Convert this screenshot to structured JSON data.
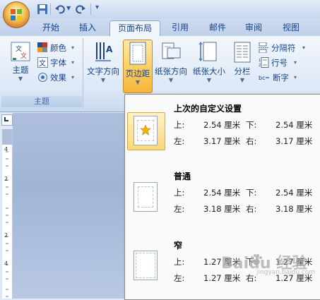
{
  "tabs": [
    "开始",
    "插入",
    "页面布局",
    "引用",
    "邮件",
    "审阅",
    "视图"
  ],
  "ribbon": {
    "theme_group": {
      "themes_label": "主题",
      "colors_label": "颜色",
      "fonts_label": "字体",
      "effects_label": "效果",
      "group_label": "主题"
    },
    "page_setup": {
      "text_direction": "文字方向",
      "margins": "页边距",
      "orientation": "纸张方向",
      "size": "纸张大小",
      "columns": "分栏",
      "breaks": "分隔符",
      "line_numbers": "行号",
      "hyphenation": "断字"
    }
  },
  "margins_menu": {
    "options": [
      {
        "name": "上次的自定义设置",
        "top": "2.54 厘米",
        "bottom": "2.54 厘米",
        "left": "3.17 厘米",
        "right": "3.17 厘米"
      },
      {
        "name": "普通",
        "top": "2.54 厘米",
        "bottom": "2.54 厘米",
        "left": "3.18 厘米",
        "right": "3.18 厘米"
      },
      {
        "name": "窄",
        "top": "1.27 厘米",
        "bottom": "1.27 厘米",
        "left": "1.27 厘米",
        "right": "1.27 厘米"
      }
    ],
    "labels": {
      "top": "上:",
      "bottom": "下:",
      "left": "左:",
      "right": "右:"
    }
  },
  "ruler": {
    "numbers": [
      "4",
      "2",
      "2",
      "4"
    ]
  },
  "watermark": {
    "text": "Baidu 经验",
    "sub": "jingyan.baidu.com"
  },
  "colors": {
    "accent_active": "#f6b53a",
    "ribbon_text": "#15428b",
    "menu_bg": "#fafafa"
  }
}
